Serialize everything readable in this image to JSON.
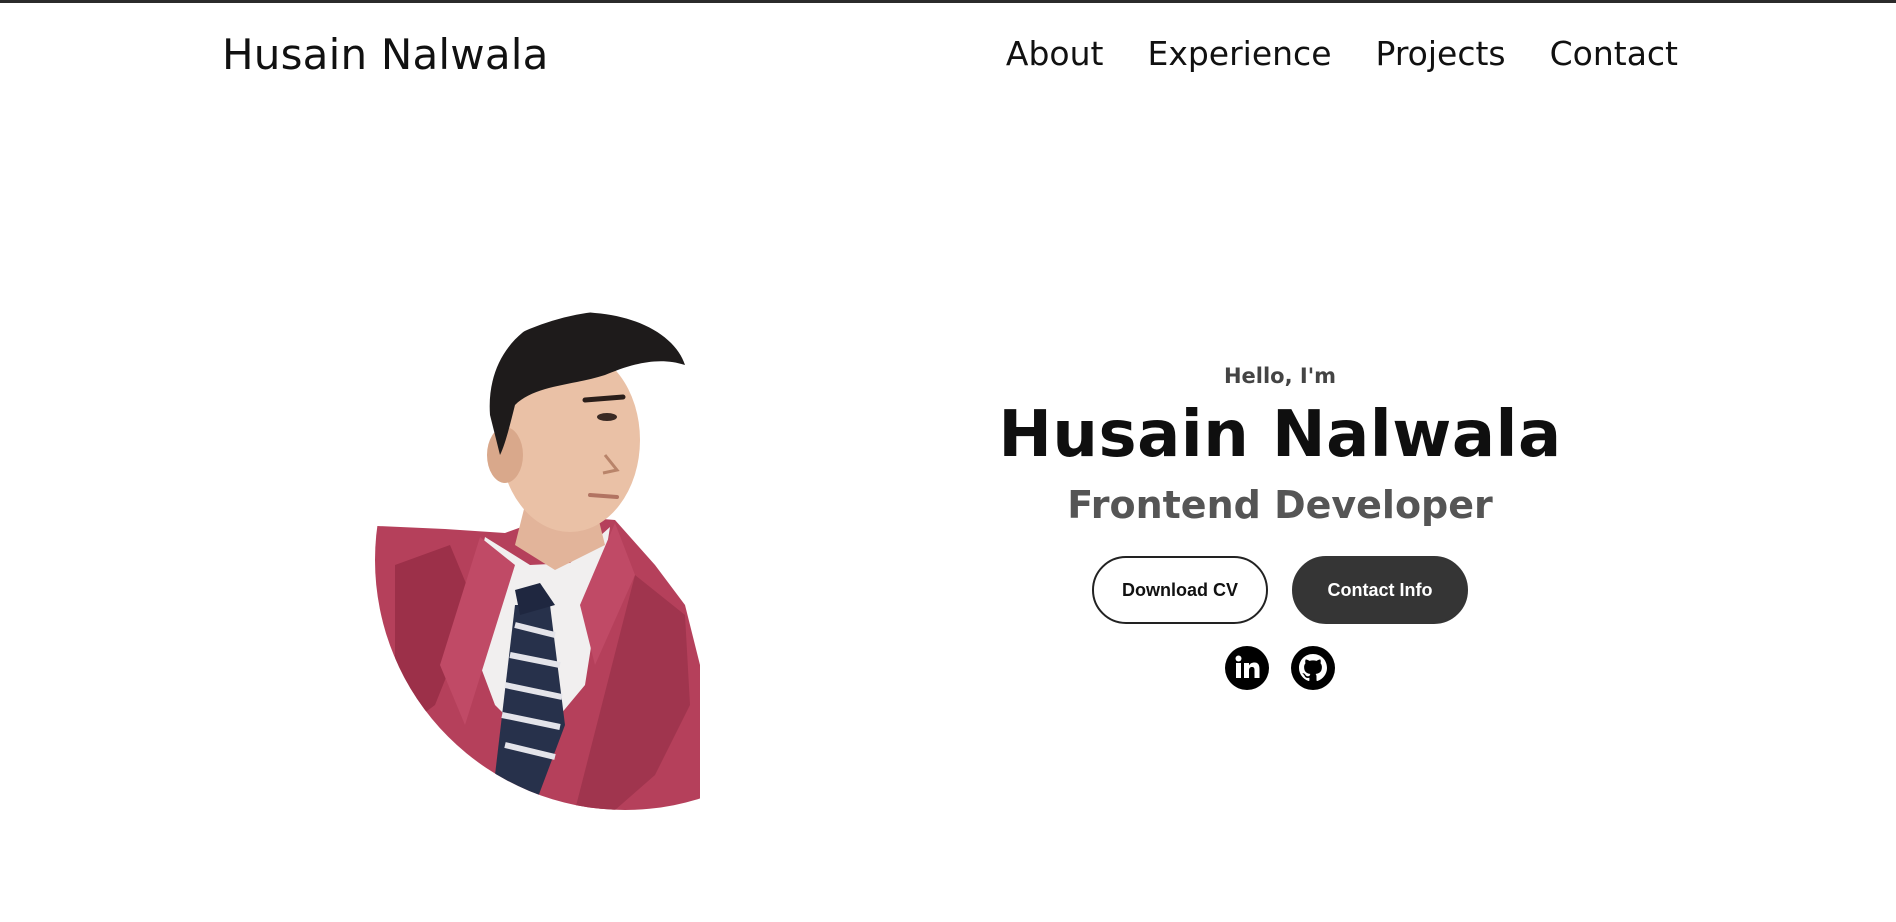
{
  "nav": {
    "logo": "Husain Nalwala",
    "links": [
      "About",
      "Experience",
      "Projects",
      "Contact"
    ]
  },
  "hero": {
    "greeting": "Hello, I'm",
    "name": "Husain Nalwala",
    "role": "Frontend Developer",
    "buttons": {
      "download_cv": "Download CV",
      "contact_info": "Contact Info"
    },
    "social_icons": [
      "linkedin-icon",
      "github-icon"
    ]
  },
  "colors": {
    "text": "#111111",
    "subtext": "#555555",
    "button_dark": "#353535",
    "blazer": "#b5405b"
  }
}
